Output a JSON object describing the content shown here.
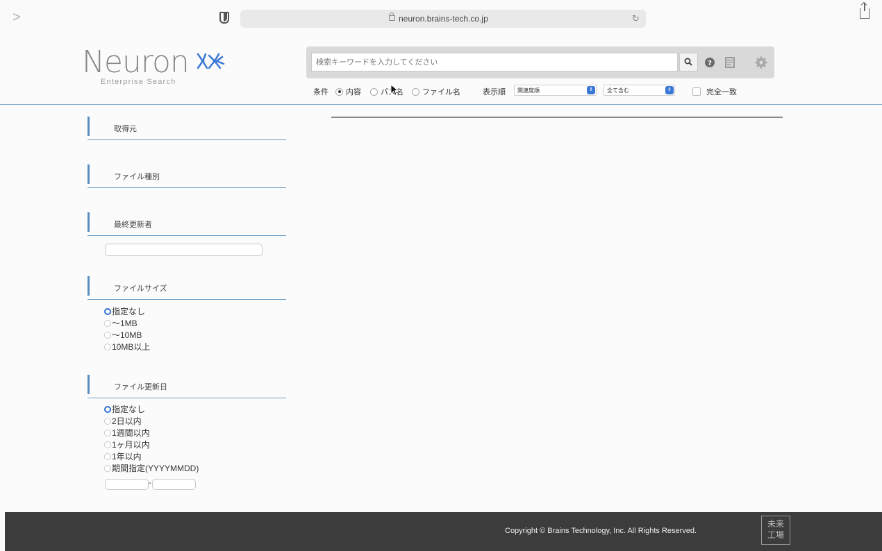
{
  "browser": {
    "url": "neuron.brains-tech.co.jp",
    "back_glyph": ">",
    "reload_glyph": "↻"
  },
  "brand": {
    "name": "Neuron",
    "subtitle": "Enterprise Search"
  },
  "search": {
    "placeholder": "検索キーワードを入力してください",
    "value": "",
    "colors": {
      "accent": "#3a78d6",
      "divider": "#7fa9c9",
      "footer_bg": "#3c3c3c"
    }
  },
  "options": {
    "condition_label": "条件",
    "condition_choices": [
      {
        "label": "内容",
        "selected": true
      },
      {
        "label": "パス名",
        "selected": false
      },
      {
        "label": "ファイル名",
        "selected": false
      }
    ],
    "order_label": "表示順",
    "order_value": "関連度順",
    "include_value": "全て含む",
    "exact_match_label": "完全一致",
    "exact_match_checked": false
  },
  "sidebar": {
    "source_title": "取得元",
    "filetype_title": "ファイル種別",
    "updater_title": "最終更新者",
    "updater_value": "",
    "size_title": "ファイルサイズ",
    "size_options": [
      {
        "label": "指定なし",
        "selected": true
      },
      {
        "label": "〜1MB",
        "selected": false
      },
      {
        "label": "〜10MB",
        "selected": false
      },
      {
        "label": "10MB以上",
        "selected": false
      }
    ],
    "date_title": "ファイル更新日",
    "date_options": [
      {
        "label": "指定なし",
        "selected": true
      },
      {
        "label": "2日以内",
        "selected": false
      },
      {
        "label": "1週間以内",
        "selected": false
      },
      {
        "label": "1ヶ月以内",
        "selected": false
      },
      {
        "label": "1年以内",
        "selected": false
      },
      {
        "label": "期間指定(YYYYMMDD)",
        "selected": false
      }
    ],
    "date_from": "",
    "date_to": "",
    "date_separator": "-"
  },
  "footer": {
    "copyright": "Copyright © Brains Technology, Inc. All Rights Reserved.",
    "badge_text": "未来工場"
  },
  "icons": [
    "shield-icon",
    "lock-icon",
    "reload-icon",
    "share-icon",
    "search-icon",
    "help-icon",
    "document-icon",
    "gear-icon",
    "logo-mark-icon"
  ]
}
